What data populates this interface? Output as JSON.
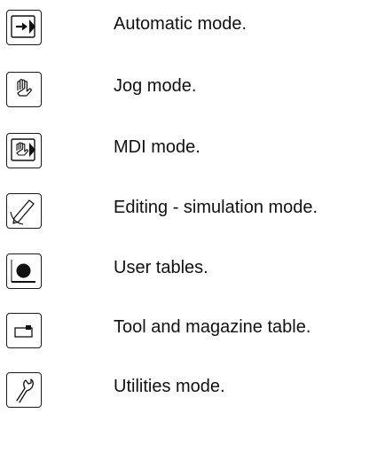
{
  "modes": [
    {
      "label": "Automatic mode.",
      "icon": "automatic-arrow-icon"
    },
    {
      "label": "Jog mode.",
      "icon": "hand-icon"
    },
    {
      "label": "MDI mode.",
      "icon": "hand-arrow-icon"
    },
    {
      "label": "Editing - simulation mode.",
      "icon": "pencil-icon"
    },
    {
      "label": "User tables.",
      "icon": "filled-dot-icon"
    },
    {
      "label": "Tool and magazine table.",
      "icon": "tool-table-icon"
    },
    {
      "label": "Utilities mode.",
      "icon": "wrench-icon"
    }
  ]
}
